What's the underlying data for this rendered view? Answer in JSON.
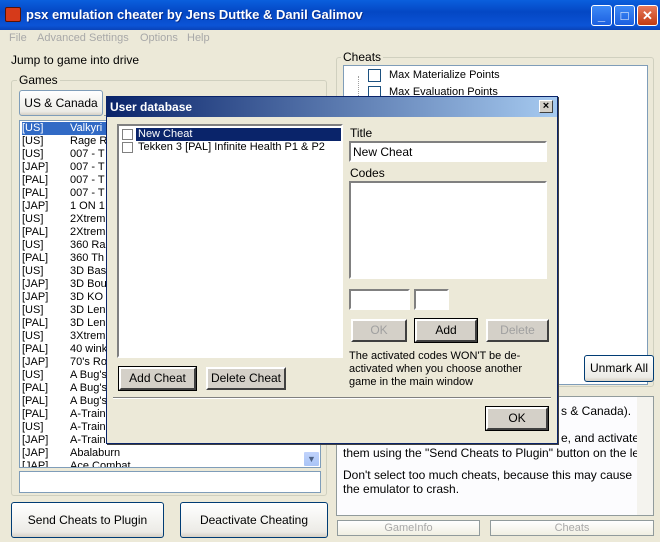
{
  "window": {
    "title": "psx emulation cheater by Jens Duttke & Danil Galimov"
  },
  "menu": [
    "File",
    "Advanced Settings",
    "Options",
    "Help"
  ],
  "left": {
    "jump_label": "Jump to game into drive",
    "games_label": "Games",
    "region_button": "US & Canada",
    "games": [
      {
        "code": "[US]",
        "name": "Valkyri"
      },
      {
        "code": "[US]",
        "name": "Rage R"
      },
      {
        "code": "[US]",
        "name": "007 - T"
      },
      {
        "code": "[JAP]",
        "name": "007 - T"
      },
      {
        "code": "[PAL]",
        "name": "007 - T"
      },
      {
        "code": "[PAL]",
        "name": "007 - T"
      },
      {
        "code": "[JAP]",
        "name": "1 ON 1"
      },
      {
        "code": "[US]",
        "name": "2Xtrem"
      },
      {
        "code": "[PAL]",
        "name": "2Xtrem"
      },
      {
        "code": "[US]",
        "name": "360 Ra"
      },
      {
        "code": "[PAL]",
        "name": "360 Th"
      },
      {
        "code": "[US]",
        "name": "3D Bas"
      },
      {
        "code": "[JAP]",
        "name": "3D Bou"
      },
      {
        "code": "[JAP]",
        "name": "3D KO"
      },
      {
        "code": "[US]",
        "name": "3D Len"
      },
      {
        "code": "[PAL]",
        "name": "3D Len"
      },
      {
        "code": "[US]",
        "name": "3Xtrem"
      },
      {
        "code": "[PAL]",
        "name": "40 wink"
      },
      {
        "code": "[JAP]",
        "name": "70's Ro"
      },
      {
        "code": "[US]",
        "name": "A Bug's"
      },
      {
        "code": "[PAL]",
        "name": "A Bug's"
      },
      {
        "code": "[PAL]",
        "name": "A Bug's"
      },
      {
        "code": "[PAL]",
        "name": "A-Train"
      },
      {
        "code": "[US]",
        "name": "A-Train"
      },
      {
        "code": "[JAP]",
        "name": "A-Train"
      },
      {
        "code": "[JAP]",
        "name": "Abalaburn"
      },
      {
        "code": "[JAP]",
        "name": "Ace Combat"
      }
    ],
    "send_button": "Send Cheats to Plugin",
    "deactivate_button": "Deactivate Cheating"
  },
  "right": {
    "cheats_label": "Cheats",
    "cheats": [
      "Max Materialize Points",
      "Max Evaluation Points"
    ],
    "unmark_button": "Unmark All",
    "info_fragment_1": "s & Canada).",
    "info_fragment_2": "e, and activate",
    "info_fragment_3": "them using the \"Send Cheats to Plugin\" button on the left.",
    "info_text": "Don't select too much cheats, because this may cause the emulator to crash.",
    "tabs": [
      "GameInfo",
      "Cheats"
    ]
  },
  "dialog": {
    "title": "User database",
    "cheats": [
      "New Cheat",
      "Tekken 3 [PAL] Infinite Health P1 & P2"
    ],
    "title_label": "Title",
    "title_value": "New Cheat",
    "codes_label": "Codes",
    "code_address": "",
    "code_value": "",
    "ok_small": "OK",
    "add": "Add",
    "delete": "Delete",
    "note": "The activated codes WON'T be de-activated when you choose another game in the main window",
    "add_cheat": "Add Cheat",
    "delete_cheat": "Delete Cheat",
    "ok": "OK"
  }
}
